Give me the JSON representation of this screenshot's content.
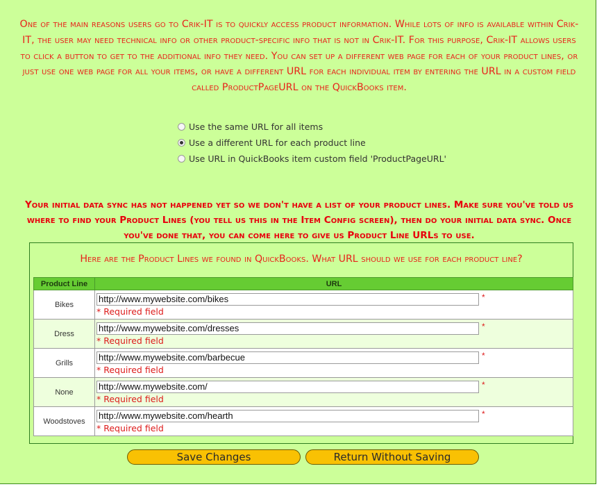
{
  "intro_text": "One of the main reasons users go to Crik-IT is to quickly access product information. While lots of info is available within Crik-IT, the user may need technical info or other product-specific info that is not in Crik-IT. For this purpose, Crik-IT allows users to click a button to get to the additional info they need. You can set up a different web page for each of your product lines, or just use one web page for all your items, or have a different URL for each individual item by entering the URL in a custom field called ProductPageURL on the QuickBooks item.",
  "url_options": [
    {
      "label": "Use the same URL for all items",
      "checked": false
    },
    {
      "label": "Use a different URL for each product line",
      "checked": true
    },
    {
      "label": "Use URL in QuickBooks item custom field 'ProductPageURL'",
      "checked": false
    }
  ],
  "warning_text": "Your initial data sync has not happened yet so we don't have a list of your product lines. Make sure you've told us where to find your Product Lines (you tell us this in the Item Config screen), then do your initial data sync. Once you've done that, you can come here to give us Product Line URLs to use.",
  "product_lines": {
    "title": "Here are the Product Lines we found in QuickBooks. What URL should we use for each product line?",
    "columns": [
      "Product Line",
      "URL"
    ],
    "required_marker": "*",
    "required_text": "* Required field",
    "rows": [
      {
        "name": "Bikes",
        "url": "http://www.mywebsite.com/bikes"
      },
      {
        "name": "Dress",
        "url": "http://www.mywebsite.com/dresses"
      },
      {
        "name": "Grills",
        "url": "http://www.mywebsite.com/barbecue"
      },
      {
        "name": "None",
        "url": "http://www.mywebsite.com/"
      },
      {
        "name": "Woodstoves",
        "url": "http://www.mywebsite.com/hearth"
      }
    ]
  },
  "buttons": {
    "save": "Save Changes",
    "return": "Return Without Saving"
  },
  "colors": {
    "panel_bg": "#ccff99",
    "text_red": "#e8231a",
    "header_green": "#66cc33",
    "button_yellow": "#f9c103"
  }
}
